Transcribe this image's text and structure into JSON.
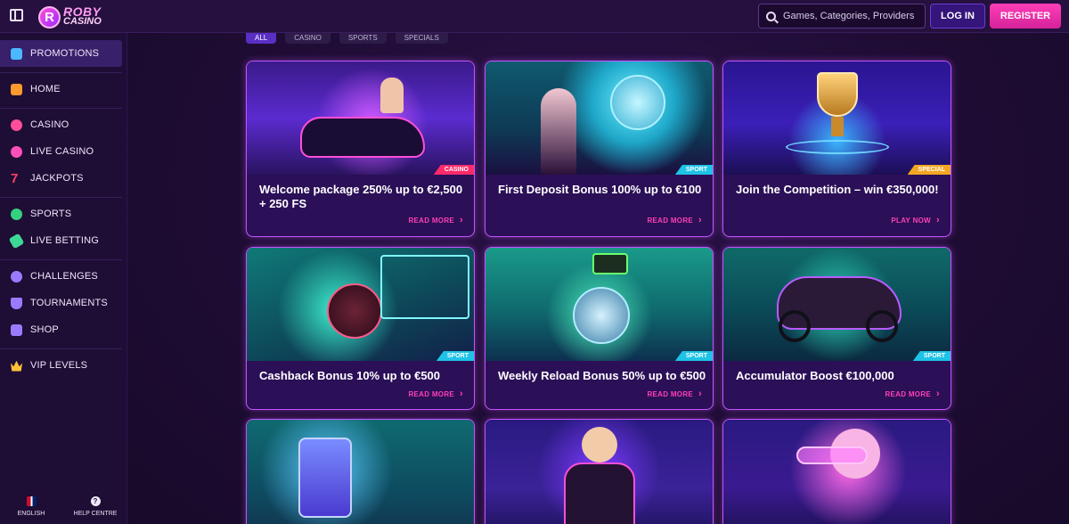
{
  "header": {
    "logo_line1": "ROBY",
    "logo_line2": "CASINO",
    "logo_letter": "R",
    "search_placeholder": "Games, Categories, Providers",
    "login_label": "LOG IN",
    "register_label": "REGISTER"
  },
  "sidebar": {
    "items": [
      {
        "label": "PROMOTIONS",
        "icon": "gift-icon",
        "color": "#4bb8ff"
      },
      {
        "label": "HOME",
        "icon": "home-icon",
        "color": "#ff9a2e"
      },
      {
        "label": "CASINO",
        "icon": "chip-icon",
        "color": "#ff4f9b"
      },
      {
        "label": "LIVE CASINO",
        "icon": "microphone-icon",
        "color": "#ff4fb8"
      },
      {
        "label": "JACKPOTS",
        "icon": "seven-icon",
        "color": "#ff3f6c"
      },
      {
        "label": "SPORTS",
        "icon": "soccer-ball-icon",
        "color": "#35d07f"
      },
      {
        "label": "LIVE BETTING",
        "icon": "ticket-icon",
        "color": "#3ed896"
      },
      {
        "label": "CHALLENGES",
        "icon": "medal-icon",
        "color": "#9a7bff"
      },
      {
        "label": "TOURNAMENTS",
        "icon": "trophy-icon",
        "color": "#9a7bff"
      },
      {
        "label": "SHOP",
        "icon": "cart-icon",
        "color": "#9a7bff"
      },
      {
        "label": "VIP LEVELS",
        "icon": "crown-icon",
        "color": "#ffc23a"
      }
    ],
    "footer": {
      "language_label": "ENGLISH",
      "help_label": "HELP CENTRE"
    }
  },
  "filters": [
    "ALL",
    "CASINO",
    "SPORTS",
    "SPECIALS"
  ],
  "cards": [
    {
      "title": "Welcome package 250% up to €2,500 + 250 FS",
      "tag": "CASINO",
      "tag_color": "#ff2a6a",
      "link": "READ MORE"
    },
    {
      "title": "First Deposit Bonus 100% up to €100",
      "tag": "SPORT",
      "tag_color": "#1ec3e6",
      "link": "READ MORE"
    },
    {
      "title": "Join the Competition – win €350,000!",
      "tag": "SPECIAL",
      "tag_color": "#f4a623",
      "link": "PLAY NOW"
    },
    {
      "title": "Cashback Bonus 10% up to €500",
      "tag": "SPORT",
      "tag_color": "#1ec3e6",
      "link": "READ MORE"
    },
    {
      "title": "Weekly Reload Bonus 50% up to €500",
      "tag": "SPORT",
      "tag_color": "#1ec3e6",
      "link": "READ MORE"
    },
    {
      "title": "Accumulator Boost €100,000",
      "tag": "SPORT",
      "tag_color": "#1ec3e6",
      "link": "READ MORE"
    }
  ],
  "colors": {
    "accent_pink": "#ff3fb8",
    "card_border": "#c455ff",
    "tag_sport": "#1ec3e6",
    "tag_casino": "#ff2a6a",
    "tag_special": "#f4a623"
  }
}
